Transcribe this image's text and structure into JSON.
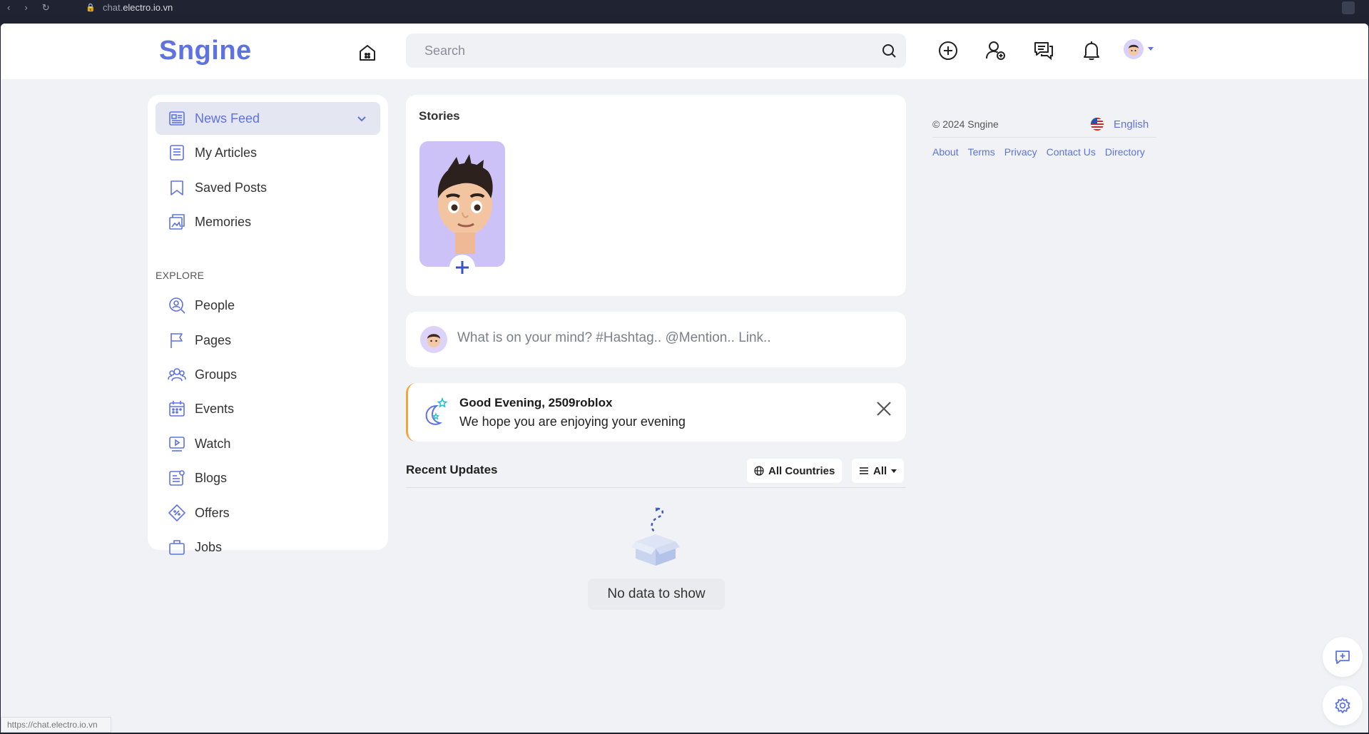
{
  "browser": {
    "url_host": "chat.",
    "url_domain": "electro.io.vn",
    "status_url": "https://chat.electro.io.vn"
  },
  "header": {
    "logo": "Sngine",
    "search_placeholder": "Search"
  },
  "sidebar": {
    "items": [
      {
        "label": "News Feed"
      },
      {
        "label": "My Articles"
      },
      {
        "label": "Saved Posts"
      },
      {
        "label": "Memories"
      }
    ],
    "explore_title": "EXPLORE",
    "explore": [
      {
        "label": "People"
      },
      {
        "label": "Pages"
      },
      {
        "label": "Groups"
      },
      {
        "label": "Events"
      },
      {
        "label": "Watch"
      },
      {
        "label": "Blogs"
      },
      {
        "label": "Offers"
      },
      {
        "label": "Jobs"
      }
    ]
  },
  "stories": {
    "title": "Stories"
  },
  "composer": {
    "placeholder": "What is on your mind? #Hashtag.. @Mention.. Link.."
  },
  "greeting": {
    "title": "Good Evening, 2509roblox",
    "message": "We hope you are enjoying your evening"
  },
  "recent": {
    "title": "Recent Updates",
    "filter_country": "All Countries",
    "filter_type": "All",
    "empty": "No data to show"
  },
  "footer": {
    "copyright": "© 2024 Sngine",
    "language": "English",
    "links": [
      "About",
      "Terms",
      "Privacy",
      "Contact Us",
      "Directory"
    ]
  },
  "colors": {
    "accent": "#5e72e4",
    "background": "#f0f2f5",
    "greeting_border": "#f2a43a",
    "story_tile": "#cdc2f7"
  }
}
